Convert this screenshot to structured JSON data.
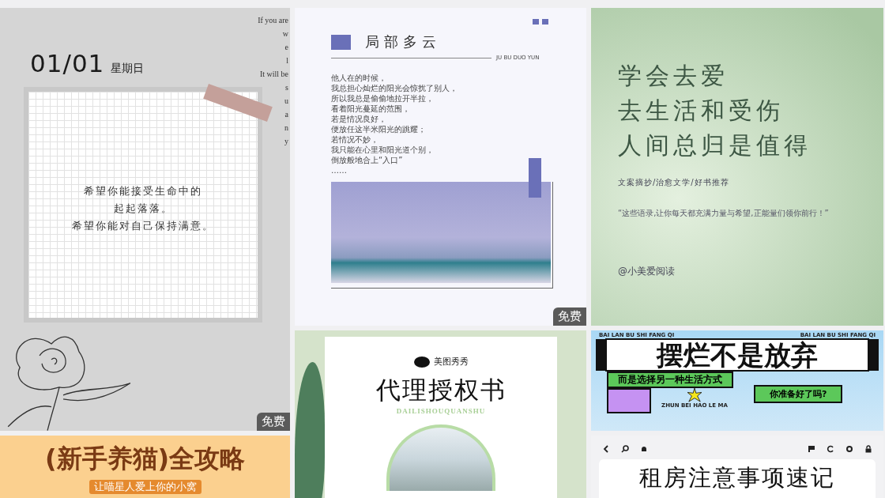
{
  "columns": [
    {
      "cards": [
        {
          "kind": "calendar",
          "date": "01/01",
          "weekday": "星期日",
          "side_text": [
            "If you are",
            "w",
            "e",
            "l",
            "It will be",
            "s",
            "u",
            "a",
            "n",
            "y"
          ],
          "lines": [
            "希望你能接受生命中的",
            "起起落落。",
            "希望你能对自己保持满意。"
          ],
          "badge": "免费"
        },
        {
          "kind": "banner",
          "title": "(新手养猫)全攻略",
          "subtitle": "让喵星人爱上你的小窝"
        }
      ]
    },
    {
      "cards": [
        {
          "kind": "article",
          "title": "局部多云",
          "pinyin": "JU BU DUO YUN",
          "lines": [
            "他人在的时候，",
            "我总担心灿烂的阳光会惊扰了别人，",
            "所以我总是偷偷地拉开半拉，",
            "看着阳光蔓延的范围，",
            "若是情况良好，",
            "便放任这半米阳光的跳耀；",
            "若情况不妙，",
            "我只能在心里和阳光道个别，",
            "倒放般地合上“入口”",
            "……"
          ],
          "badge": "免费"
        },
        {
          "kind": "certificate",
          "brand": "美图秀秀",
          "title": "代理授权书",
          "pinyin": "DAILISHOUQUANSHU"
        }
      ]
    },
    {
      "cards": [
        {
          "kind": "quote",
          "lines": [
            "学会去爱",
            "去生活和受伤",
            "人间总归是值得"
          ],
          "tags": "文案摘抄/治愈文学/好书推荐",
          "quote": "“这些语录,让你每天都充满力量与希望,正能量们领你前行！”",
          "handle": "@小美爱阅读"
        },
        {
          "kind": "poster",
          "top_left": "BAI LAN BU SHI FANG QI",
          "top_right": "BAI LAN BU SHI FANG QI",
          "title": "摆烂不是放弃",
          "subtitle": "而是选择另一种生活方式",
          "question": "你准备好了吗?",
          "small": "ZHUN BEI HAO LE MA"
        },
        {
          "kind": "note",
          "title": "租房注意事项速记"
        }
      ]
    }
  ]
}
